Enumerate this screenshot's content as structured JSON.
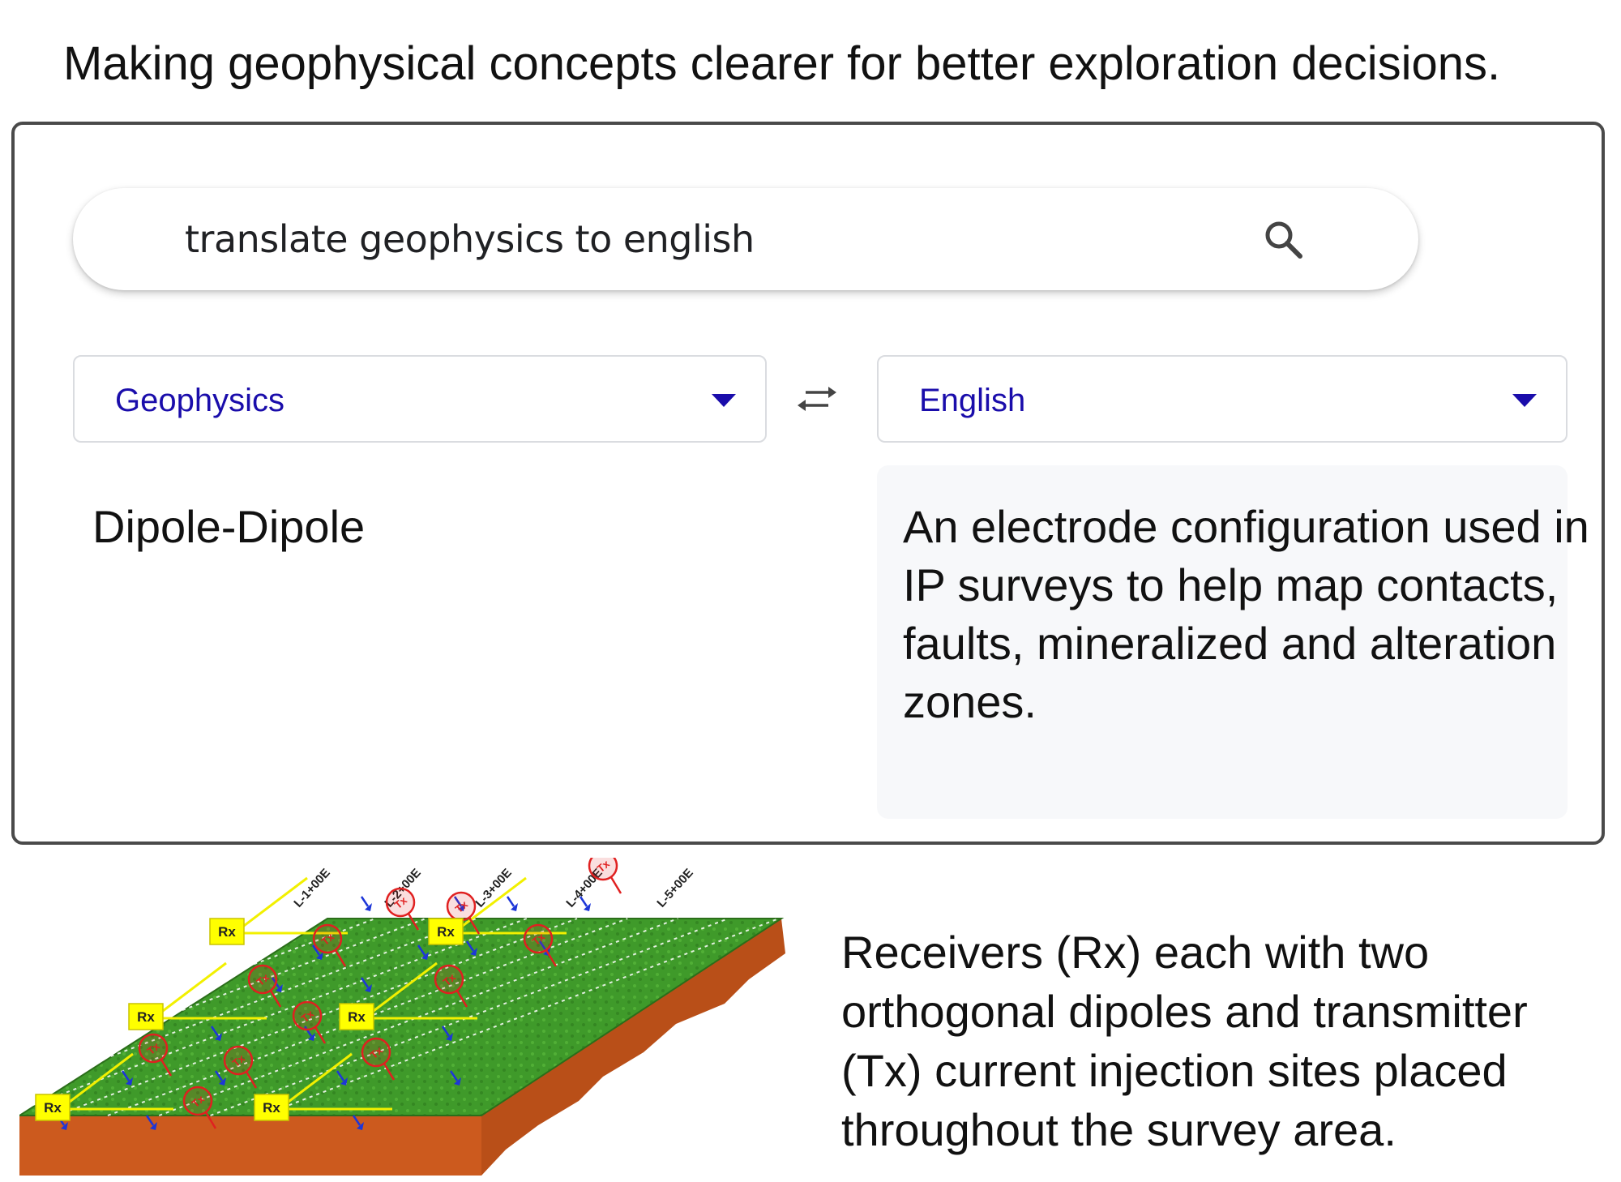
{
  "headline": "Making geophysical concepts clearer for better exploration decisions.",
  "search": {
    "query": "translate geophysics to english",
    "icon": "search-icon"
  },
  "translator": {
    "source_language": "Geophysics",
    "target_language": "English",
    "source_text": "Dipole-Dipole",
    "target_text": "An electrode configuration used in IP surveys to help map contacts, faults, mineralized and alteration zones.",
    "link_color": "#1a0dab"
  },
  "diagram": {
    "lines": [
      "L-1+00E",
      "L-2+00E",
      "L-3+00E",
      "L-4+00E",
      "L-5+00E"
    ],
    "receiver_label": "Rx",
    "transmitter_label": "Tx",
    "colors": {
      "grass": "#3f9a2a",
      "soil": "#cc5a1e",
      "rx_box": "#ffff00",
      "tx": "#e02020",
      "arrow": "#1d36d8"
    }
  },
  "caption": "Receivers (Rx) each with two orthogonal dipoles and transmitter (Tx) current injection sites placed throughout the survey area."
}
